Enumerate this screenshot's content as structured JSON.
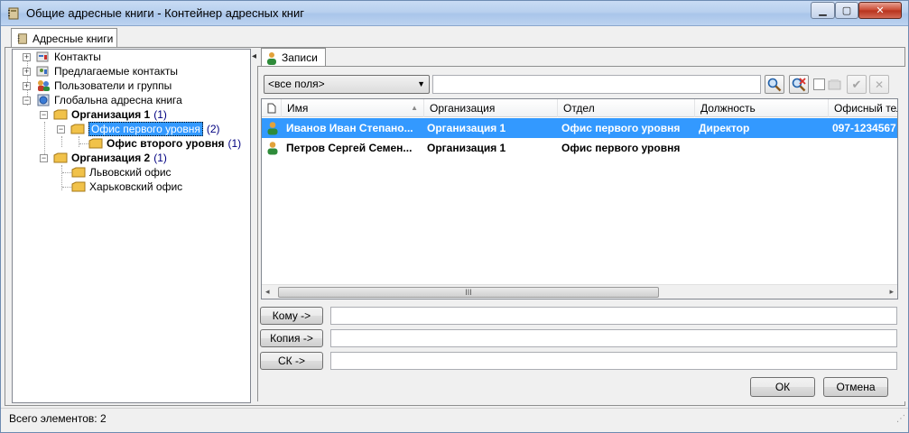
{
  "window": {
    "title": "Общие адресные книги - Контейнер адресных книг"
  },
  "outer_tab": {
    "label": "Адресные книги"
  },
  "tree": {
    "items": [
      {
        "label": "Контакты"
      },
      {
        "label": "Предлагаемые контакты"
      },
      {
        "label": "Пользователи и группы"
      },
      {
        "label": "Глобальна адресна книга"
      },
      {
        "label": "Организация 1",
        "count": "(1)"
      },
      {
        "label": "Офис первого уровня",
        "count": "(2)"
      },
      {
        "label": "Офис второго уровня",
        "count": "(1)"
      },
      {
        "label": "Организация 2",
        "count": "(1)"
      },
      {
        "label": "Львовский офис"
      },
      {
        "label": "Харьковский офис"
      }
    ]
  },
  "inner_tab": {
    "label": "Записи"
  },
  "search": {
    "field_selector": "<все поля>",
    "query": ""
  },
  "list": {
    "columns": [
      "Имя",
      "Организация",
      "Отдел",
      "Должность",
      "Офисный теле"
    ],
    "rows": [
      {
        "name": "Иванов Иван Степано...",
        "org": "Организация 1",
        "dept": "Офис первого уровня",
        "position": "Директор",
        "phone": "097-1234567"
      },
      {
        "name": "Петров Сергей Семен...",
        "org": "Организация 1",
        "dept": "Офис первого уровня",
        "position": "",
        "phone": ""
      }
    ],
    "scroll_thumb": "III"
  },
  "recipients": {
    "to_label": "Кому ->",
    "cc_label": "Копия ->",
    "bcc_label": "СК ->"
  },
  "dialog": {
    "ok_label": "ОК",
    "cancel_label": "Отмена"
  },
  "status": {
    "text": "Всего элементов: 2"
  },
  "icons": {
    "title": "address-book-icon",
    "contacts": "contacts-icon",
    "search": "search-icon",
    "filter": "filter-icon",
    "check": "check-icon",
    "delete": "delete-icon"
  },
  "colors": {
    "selection": "#3399ff",
    "count_text": "#000080"
  }
}
